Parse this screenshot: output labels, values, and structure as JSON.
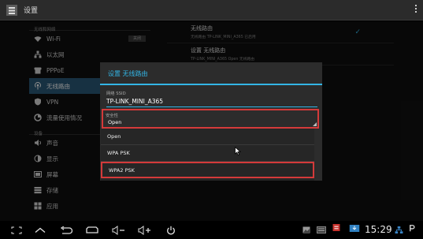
{
  "titlebar": {
    "title": "设置"
  },
  "sidebar": {
    "section_network": "无线和网络",
    "section_device": "设备",
    "items": [
      {
        "label": "Wi-Fi",
        "icon": "wifi-icon",
        "toggle": "关闭"
      },
      {
        "label": "以太网",
        "icon": "ethernet-icon"
      },
      {
        "label": "PPPoE",
        "icon": "phone-icon"
      },
      {
        "label": "无线路由",
        "icon": "hotspot-icon",
        "selected": true
      },
      {
        "label": "VPN",
        "icon": "vpn-icon"
      },
      {
        "label": "流量使用情况",
        "icon": "data-usage-icon"
      },
      {
        "label": "声音",
        "icon": "speaker-icon"
      },
      {
        "label": "显示",
        "icon": "display-icon"
      },
      {
        "label": "屏幕",
        "icon": "screen-icon"
      },
      {
        "label": "存储",
        "icon": "storage-icon"
      },
      {
        "label": "应用",
        "icon": "apps-icon"
      }
    ]
  },
  "detail": {
    "items": [
      {
        "title": "无线路由",
        "subtitle": "无线路由 TP-LINK_MINI_A365 已启用",
        "checked": true
      },
      {
        "title": "设置 无线路由",
        "subtitle": "TP-LINK_MINI_A365 Open 无线路由"
      }
    ]
  },
  "dialog": {
    "title": "设置 无线路由",
    "ssid_label": "网络 SSID",
    "ssid_value": "TP-LINK_MINI_A365",
    "security_label": "安全性",
    "security_value": "Open",
    "options": [
      "Open",
      "WPA PSK",
      "WPA2 PSK"
    ],
    "highlighted_option": "WPA2 PSK"
  },
  "statusbar": {
    "time": "15:29"
  },
  "colors": {
    "accent": "#33b5e5",
    "highlight": "#d43a3a",
    "selected": "#2a5a78"
  }
}
